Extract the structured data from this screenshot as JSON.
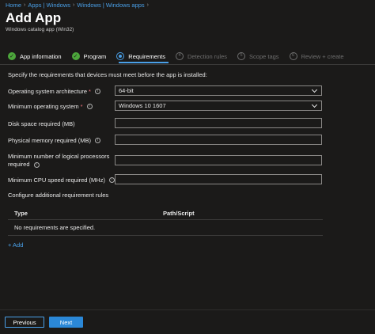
{
  "breadcrumb": [
    "Home",
    "Apps | Windows",
    "Windows | Windows apps"
  ],
  "title": "Add App",
  "subtitle": "Windows catalog app (Win32)",
  "steps": [
    {
      "label": "App information",
      "state": "done"
    },
    {
      "label": "Program",
      "state": "done"
    },
    {
      "label": "Requirements",
      "state": "active"
    },
    {
      "label": "Detection rules",
      "state": "pending",
      "num": "4"
    },
    {
      "label": "Scope tags",
      "state": "pending",
      "num": "5"
    },
    {
      "label": "Review + create",
      "state": "pending",
      "num": "6"
    }
  ],
  "intro": "Specify the requirements that devices must meet before the app is installed:",
  "fields": {
    "os_arch": {
      "label": "Operating system architecture",
      "required": "*",
      "value": "64-bit"
    },
    "min_os": {
      "label": "Minimum operating system",
      "required": "*",
      "value": "Windows 10 1607"
    },
    "disk": {
      "label": "Disk space required (MB)",
      "value": ""
    },
    "memory": {
      "label": "Physical memory required (MB)",
      "value": ""
    },
    "cpu_count": {
      "label_line1": "Minimum number of logical processors",
      "label_line2": "required",
      "value": ""
    },
    "cpu_speed": {
      "label": "Minimum CPU speed required (MHz)",
      "value": ""
    }
  },
  "configure_text": "Configure additional requirement rules",
  "table": {
    "columns": [
      "Type",
      "Path/Script"
    ],
    "empty_text": "No requirements are specified."
  },
  "add_link": "+ Add",
  "buttons": {
    "previous": "Previous",
    "next": "Next"
  },
  "colors": {
    "accent": "#2b88d8",
    "link": "#4aa0e8",
    "done": "#4ca63b",
    "background": "#1b1a19"
  }
}
